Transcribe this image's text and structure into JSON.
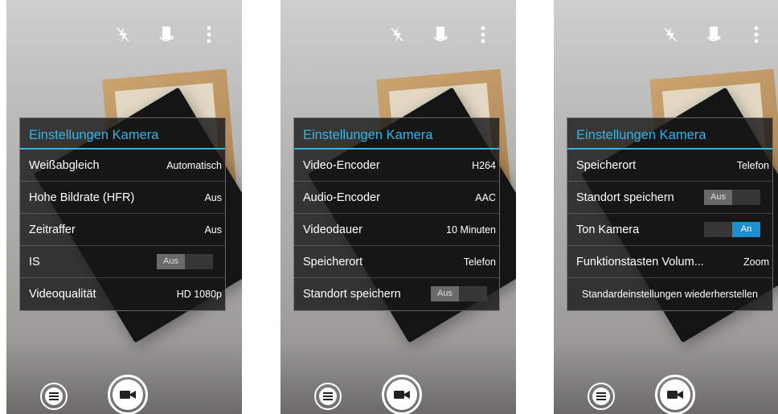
{
  "screens": [
    {
      "panel": {
        "title": "Einstellungen Kamera",
        "rows": [
          {
            "label": "Weißabgleich",
            "value": "Automatisch"
          },
          {
            "label": "Hohe Bildrate (HFR)",
            "value": "Aus"
          },
          {
            "label": "Zeitraffer",
            "value": "Aus"
          },
          {
            "label": "IS",
            "toggle_off": "Aus"
          },
          {
            "label": "Videoqualität",
            "value": "HD 1080p"
          }
        ]
      }
    },
    {
      "panel": {
        "title": "Einstellungen Kamera",
        "rows": [
          {
            "label": "Video-Encoder",
            "value": "H264"
          },
          {
            "label": "Audio-Encoder",
            "value": "AAC"
          },
          {
            "label": "Videodauer",
            "value": "10 Minuten"
          },
          {
            "label": "Speicherort",
            "value": "Telefon"
          },
          {
            "label": "Standort speichern",
            "toggle_off": "Aus"
          }
        ]
      }
    },
    {
      "panel": {
        "title": "Einstellungen Kamera",
        "rows": [
          {
            "label": "Speicherort",
            "value": "Telefon"
          },
          {
            "label": "Standort speichern",
            "toggle_off": "Aus"
          },
          {
            "label": "Ton Kamera",
            "toggle_on": "An"
          },
          {
            "label": "Funktionstasten Volum...",
            "value": "Zoom"
          },
          {
            "label": "Standardeinstellungen wiederherstellen"
          }
        ]
      }
    }
  ],
  "icons": {
    "flash": "flash-off-icon",
    "rotate": "camera-switch-icon",
    "overflow": "more-vertical-icon",
    "menu": "menu-icon",
    "shutter": "video-camera-icon"
  },
  "colors": {
    "accent": "#33b5e5",
    "toggle_on": "#1d8fd0"
  }
}
